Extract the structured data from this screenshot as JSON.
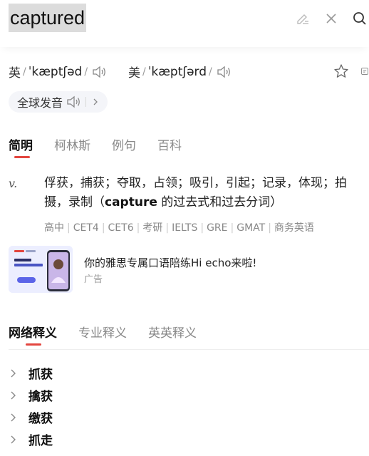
{
  "search": {
    "query": "captured"
  },
  "toolbar": {
    "edit_icon": "pencil-clear-icon",
    "clear_icon": "close-icon",
    "search_icon": "search-icon"
  },
  "pronunciation": {
    "uk": {
      "label": "英",
      "ipa": "ˈkæptʃəd"
    },
    "us": {
      "label": "美",
      "ipa": "ˈkæptʃərd"
    },
    "global_label": "全球发音"
  },
  "tabs": [
    {
      "label": "简明",
      "active": true
    },
    {
      "label": "柯林斯",
      "active": false
    },
    {
      "label": "例句",
      "active": false
    },
    {
      "label": "百科",
      "active": false
    }
  ],
  "definition": {
    "pos": "v.",
    "text_before": "俘获，捕获；夺取，占领；吸引，引起；记录，体现；拍摄，录制（",
    "word": "capture",
    "text_after": " 的过去式和过去分词）"
  },
  "levels": [
    "高中",
    "CET4",
    "CET6",
    "考研",
    "IELTS",
    "GRE",
    "GMAT",
    "商务英语"
  ],
  "ad": {
    "title": "你的雅思专属口语陪练Hi echo来啦!",
    "label": "广告"
  },
  "tabs2": [
    {
      "label": "网络释义",
      "active": true
    },
    {
      "label": "专业释义",
      "active": false
    },
    {
      "label": "英英释义",
      "active": false
    }
  ],
  "web_meanings": [
    "抓获",
    "擒获",
    "缴获",
    "抓走"
  ],
  "colors": {
    "accent": "#e3463f",
    "chip_bg": "#f4f5f9"
  }
}
